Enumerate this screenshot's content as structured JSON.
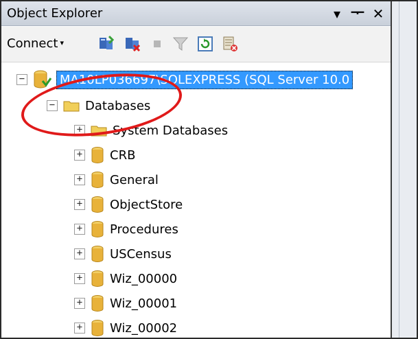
{
  "window": {
    "title": "Object Explorer",
    "controls": [
      "▾",
      "ㅁ",
      "✕"
    ]
  },
  "toolbar": {
    "connect_label": "Connect",
    "connect_caret": "▾",
    "icons": [
      "connect-object-explorer-icon",
      "disconnect-icon",
      "stop-icon",
      "filter-icon",
      "refresh-icon",
      "start-powershell-icon"
    ]
  },
  "tree": {
    "server": {
      "expander": "−",
      "label": "MA10LP036697\\SQLEXPRESS (SQL Server 10.0"
    },
    "databases": {
      "expander": "−",
      "label": "Databases"
    },
    "items": [
      {
        "expander": "+",
        "label": "System Databases",
        "icon": "folder"
      },
      {
        "expander": "+",
        "label": "CRB",
        "icon": "database"
      },
      {
        "expander": "+",
        "label": "General",
        "icon": "database"
      },
      {
        "expander": "+",
        "label": "ObjectStore",
        "icon": "database"
      },
      {
        "expander": "+",
        "label": "Procedures",
        "icon": "database"
      },
      {
        "expander": "+",
        "label": "USCensus",
        "icon": "database"
      },
      {
        "expander": "+",
        "label": "Wiz_00000",
        "icon": "database"
      },
      {
        "expander": "+",
        "label": "Wiz_00001",
        "icon": "database"
      },
      {
        "expander": "+",
        "label": "Wiz_00002",
        "icon": "database"
      }
    ]
  },
  "colors": {
    "selection": "#3399ff",
    "annotation": "#e01a1a",
    "db_icon": "#e8b23a",
    "folder_icon": "#f1cf5a"
  }
}
